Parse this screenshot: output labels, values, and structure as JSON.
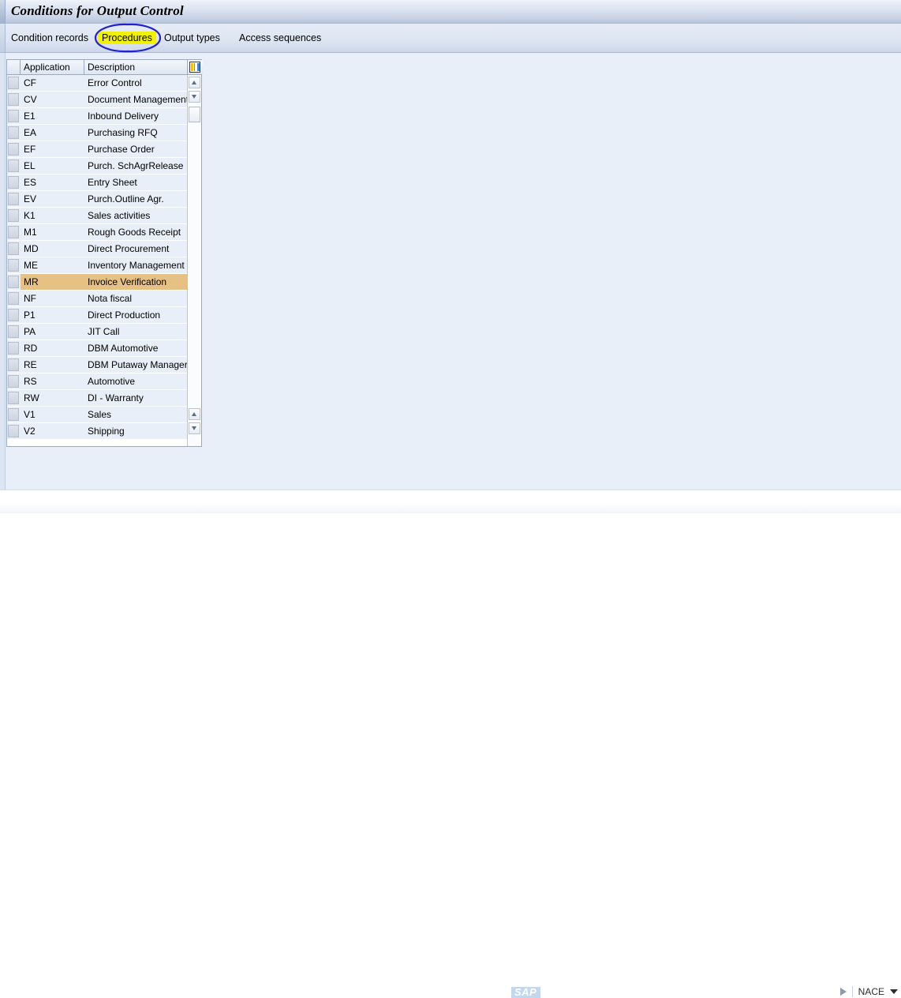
{
  "window": {
    "title": "Conditions for Output Control"
  },
  "tabs": [
    {
      "label": "Condition records",
      "highlighted": false
    },
    {
      "label": "Procedures",
      "highlighted": true
    },
    {
      "label": "Output types",
      "highlighted": false
    },
    {
      "label": "Access sequences",
      "highlighted": false
    }
  ],
  "annotation": {
    "type": "hand-drawn-ellipse",
    "color": "#2222cc",
    "highlight_color": "#f2f200",
    "target": "Procedures"
  },
  "table": {
    "columns": [
      "Application",
      "Description"
    ],
    "config_icon": "table-settings-icon",
    "selected_key": "MR",
    "rows": [
      {
        "application": "CF",
        "description": "Error Control"
      },
      {
        "application": "CV",
        "description": "Document Management"
      },
      {
        "application": "E1",
        "description": "Inbound Delivery"
      },
      {
        "application": "EA",
        "description": "Purchasing RFQ"
      },
      {
        "application": "EF",
        "description": "Purchase Order"
      },
      {
        "application": "EL",
        "description": "Purch. SchAgrRelease"
      },
      {
        "application": "ES",
        "description": "Entry Sheet"
      },
      {
        "application": "EV",
        "description": "Purch.Outline Agr."
      },
      {
        "application": "K1",
        "description": "Sales activities"
      },
      {
        "application": "M1",
        "description": "Rough Goods Receipt"
      },
      {
        "application": "MD",
        "description": "Direct Procurement"
      },
      {
        "application": "ME",
        "description": "Inventory Management"
      },
      {
        "application": "MR",
        "description": "Invoice Verification"
      },
      {
        "application": "NF",
        "description": "Nota fiscal"
      },
      {
        "application": "P1",
        "description": "Direct Production"
      },
      {
        "application": "PA",
        "description": "JIT Call"
      },
      {
        "application": "RD",
        "description": "DBM Automotive"
      },
      {
        "application": "RE",
        "description": "DBM Putaway Manager"
      },
      {
        "application": "RS",
        "description": "Automotive"
      },
      {
        "application": "RW",
        "description": "DI - Warranty"
      },
      {
        "application": "V1",
        "description": "Sales"
      },
      {
        "application": "V2",
        "description": "Shipping"
      }
    ]
  },
  "statusbar": {
    "logo": "SAP",
    "transaction": "NACE"
  },
  "colors": {
    "selected_row": "#e7c184",
    "row_background": "#e8eff8",
    "content_background": "#e9eff8",
    "annotation_blue": "#2222cc",
    "highlight_yellow": "#f2f200"
  }
}
